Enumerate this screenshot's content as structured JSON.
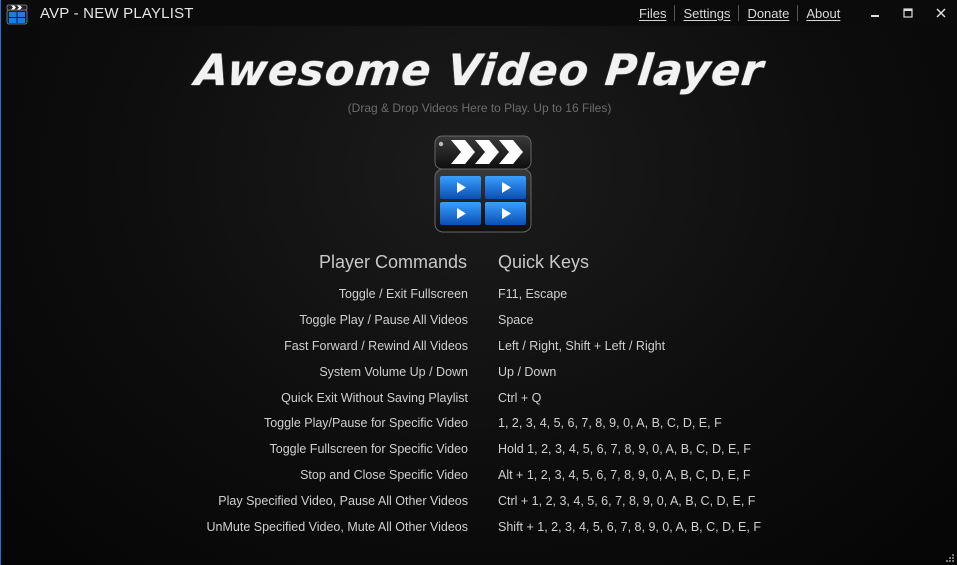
{
  "window": {
    "title": "AVP - NEW PLAYLIST",
    "app_icon": "clapperboard-icon"
  },
  "menu": {
    "files": "Files",
    "settings": "Settings",
    "donate": "Donate",
    "about": "About"
  },
  "controls": {
    "minimize": "minimize-icon",
    "maximize": "maximize-icon",
    "close": "close-icon"
  },
  "main": {
    "title": "Awesome Video Player",
    "subtitle": "(Drag & Drop Videos Here to Play. Up to 16 Files)",
    "logo": "video-player-logo-icon",
    "commands_header": "Player Commands",
    "keys_header": "Quick Keys",
    "commands": [
      {
        "command": "Toggle / Exit Fullscreen",
        "keys": "F11, Escape"
      },
      {
        "command": "Toggle Play / Pause All Videos",
        "keys": "Space"
      },
      {
        "command": "Fast Forward / Rewind All Videos",
        "keys": "Left / Right, Shift + Left / Right"
      },
      {
        "command": "System Volume Up / Down",
        "keys": "Up / Down"
      },
      {
        "command": "Quick Exit Without Saving Playlist",
        "keys": "Ctrl + Q"
      },
      {
        "command": "Toggle Play/Pause for Specific Video",
        "keys": "1, 2, 3, 4, 5, 6, 7, 8, 9, 0, A, B, C, D, E, F"
      },
      {
        "command": "Toggle Fullscreen for Specific Video",
        "keys": "Hold 1, 2, 3, 4, 5, 6, 7, 8, 9, 0, A, B, C, D, E, F"
      },
      {
        "command": "Stop and Close Specific Video",
        "keys": "Alt + 1, 2, 3, 4, 5, 6, 7, 8, 9, 0, A, B, C, D, E, F"
      },
      {
        "command": "Play Specified Video, Pause All Other Videos",
        "keys": "Ctrl + 1, 2, 3, 4, 5, 6, 7, 8, 9, 0, A, B, C, D, E, F"
      },
      {
        "command": "UnMute Specified Video, Mute All Other Videos",
        "keys": "Shift + 1, 2, 3, 4, 5, 6, 7, 8, 9, 0, A, B, C, D, E, F"
      }
    ]
  },
  "colors": {
    "background": "#0d0d0d",
    "titlebar": "#0b0b0b",
    "accent_blue": "#1e7be0",
    "window_border": "#2b6fd6"
  }
}
